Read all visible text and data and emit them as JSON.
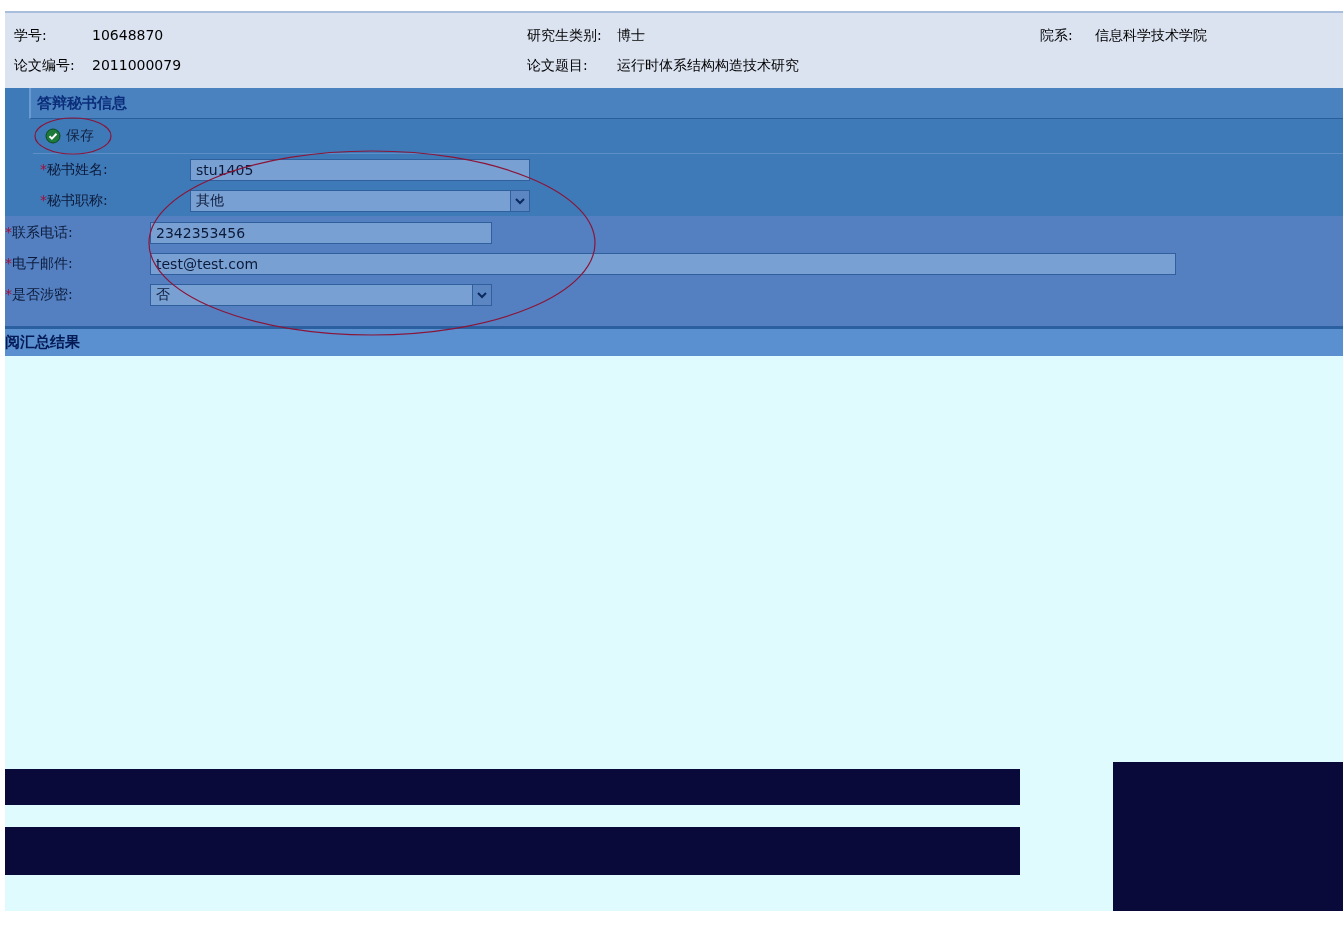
{
  "info": [
    {
      "label": "学号:",
      "value": "10648870"
    },
    {
      "label": "研究生类别:",
      "value": "博士"
    },
    {
      "label": "院系:",
      "value": "信息科学技术学院"
    },
    {
      "label": "论文编号:",
      "value": "2011000079"
    },
    {
      "label": "论文题目:",
      "value": "运行时体系结构构造技术研究"
    }
  ],
  "panel": {
    "title": "答辩秘书信息",
    "save_button": "保存"
  },
  "fields_upper": [
    {
      "mark": "*",
      "label": "秘书姓名:",
      "kind": "text",
      "value": "stu1405"
    },
    {
      "mark": "*",
      "label": "秘书职称:",
      "kind": "select",
      "value": "其他"
    }
  ],
  "fields_lower": [
    {
      "mark": "*",
      "label": "联系电话:",
      "kind": "text",
      "value": "2342353456"
    },
    {
      "mark": "*",
      "label": "电子邮件:",
      "kind": "wide",
      "value": "test@test.com"
    },
    {
      "mark": "*",
      "label": "是否涉密:",
      "kind": "select",
      "value": "否"
    }
  ],
  "section2": {
    "title": "阅汇总结果"
  }
}
